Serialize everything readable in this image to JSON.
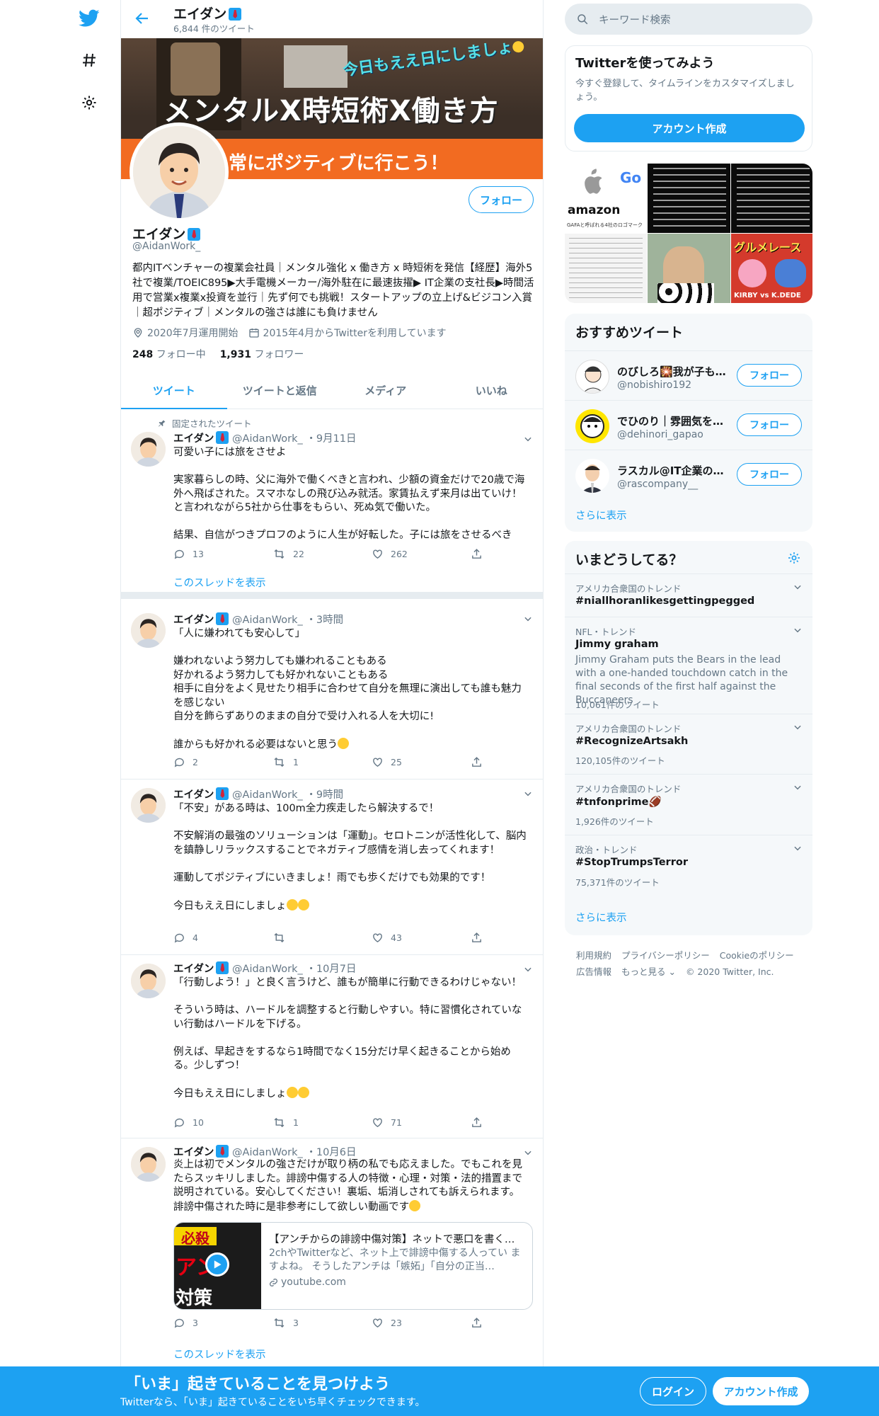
{
  "nav": {
    "icons": [
      "twitter-logo-icon",
      "explore-hashtag-icon",
      "settings-gear-icon"
    ]
  },
  "header": {
    "name": "エイダン",
    "tweet_count": "6,844 件のツイート"
  },
  "banner": {
    "line1": "メンタルX時短術X働き方",
    "line2": "今日もええ日にしましょ",
    "line3": "常にポジティブに行こう！"
  },
  "profile": {
    "follow_label": "フォロー",
    "name": "エイダン",
    "handle": "@AidanWork_",
    "bio": "都内ITベンチャーの複業会社員｜メンタル強化 x 働き方 x 時短術を発信【経歴】海外5社で複業/TOEIC895▶大手電機メーカー/海外駐在に最速抜擢▶ IT企業の支社長▶時間活用で営業x複業x投資を並行｜先ず何でも挑戦！スタートアップの立上げ&ビジコン入賞｜超ポジティブ｜メンタルの強さは誰にも負けません",
    "meta_started": "2020年7月運用開始",
    "meta_joined": "2015年4月からTwitterを利用しています",
    "following_count": "248",
    "following_label": "フォロー中",
    "followers_count": "1,931",
    "followers_label": "フォロワー"
  },
  "tabs": [
    "ツイート",
    "ツイートと返信",
    "メディア",
    "いいね"
  ],
  "tweets": [
    {
      "pinned_label": "固定されたツイート",
      "name": "エイダン",
      "handle": "@AidanWork_",
      "time": "・9月11日",
      "text": "可愛い子には旅をさせよ\n\n実家暮らしの時、父に海外で働くべきと言われ、少額の資金だけで20歳で海外へ飛ばされた。スマホなしの飛び込み就活。家賃払えず来月は出ていけ！と言われながら5社から仕事をもらい、死ぬ気で働いた。\n\n結果、自信がつきプロフのように人生が好転した。子には旅をさせるべき",
      "replies": "13",
      "retweets": "22",
      "likes": "262",
      "thread_label": "このスレッドを表示"
    },
    {
      "name": "エイダン",
      "handle": "@AidanWork_",
      "time": "・3時間",
      "text": "「人に嫌われても安心して」\n\n嫌われないよう努力しても嫌われることもある\n好かれるよう努力しても好かれないこともある\n相手に自分をよく見せたり相手に合わせて自分を無理に演出しても誰も魅力を感じない\n自分を飾らずありのままの自分で受け入れる人を大切に!\n\n誰からも好かれる必要はないと思う",
      "replies": "2",
      "retweets": "1",
      "likes": "25"
    },
    {
      "name": "エイダン",
      "handle": "@AidanWork_",
      "time": "・9時間",
      "text": "「不安」がある時は、100m全力疾走したら解決するで！\n\n不安解消の最強のソリューションは「運動」。セロトニンが活性化して、脳内を鎮静しリラックスすることでネガティブ感情を消し去ってくれます！\n\n運動してポジティブにいきましょ！雨でも歩くだけでも効果的です！\n\n今日もええ日にしましょ",
      "replies": "4",
      "retweets": "",
      "likes": "43"
    },
    {
      "name": "エイダン",
      "handle": "@AidanWork_",
      "time": "・10月7日",
      "text": "「行動しよう！」と良く言うけど、誰もが簡単に行動できるわけじゃない！\n\nそういう時は、ハードルを調整すると行動しやすい。特に習慣化されていない行動はハードルを下げる。\n\n例えば、早起きをするなら1時間でなく15分だけ早く起きることから始める。少しずつ！\n\n今日もええ日にしましょ",
      "replies": "10",
      "retweets": "1",
      "likes": "71"
    },
    {
      "name": "エイダン",
      "handle": "@AidanWork_",
      "time": "・10月6日",
      "text": "炎上は初でメンタルの強さだけが取り柄の私でも応えました。でもこれを見たらスッキリしました。誹謗中傷する人の特徴・心理・対策・法的措置まで説明されている。安心してください！裏垢、垢消しされても訴えられます。誹謗中傷された時に是非参考にして欲しい動画です",
      "card_title": "【アンチからの誹謗中傷対策】ネットで悪口を書く…",
      "card_desc": "2chやTwitterなど、ネット上で誹謗中傷する人ってい ますよね。 そうしたアンチは「嫉妬」「自分の正当…",
      "card_domain": "youtube.com",
      "card_thumb_top": "必殺",
      "card_thumb_mid": "アン",
      "card_thumb_bot": "対策",
      "replies": "3",
      "retweets": "3",
      "likes": "23",
      "thread_label": "このスレッドを表示"
    }
  ],
  "right": {
    "search_placeholder": "キーワード検索",
    "promo": {
      "title": "Twitterを使ってみよう",
      "desc": "今すぐ登録して、タイムラインをカスタマイズしましょう。",
      "button": "アカウント作成"
    },
    "wtf": {
      "title": "おすすめツイート",
      "users": [
        {
          "name": "のびしろ🎇我が子も…",
          "handle": "@nobishiro192",
          "follow": "フォロー"
        },
        {
          "name": "でひのり｜雰囲気を…",
          "handle": "@dehinori_gapao",
          "follow": "フォロー"
        },
        {
          "name": "ラスカル@IT企業の…",
          "handle": "@rascompany__",
          "follow": "フォロー"
        }
      ],
      "more": "さらに表示"
    },
    "trends": {
      "title": "いまどうしてる？",
      "items": [
        {
          "context": "アメリカ合衆国のトレンド",
          "topic": "#niallhoranlikesgettingpegged",
          "desc": "",
          "count": ""
        },
        {
          "context": "NFL・トレンド",
          "topic": "Jimmy graham",
          "desc": "Jimmy Graham puts the Bears in the lead with a one-handed touchdown catch in the final seconds of the first half against the Buccaneers",
          "count": "10,061件のツイート"
        },
        {
          "context": "アメリカ合衆国のトレンド",
          "topic": "#RecognizeArtsakh",
          "desc": "",
          "count": "120,105件のツイート"
        },
        {
          "context": "アメリカ合衆国のトレンド",
          "topic": "#tnfonprime🏈",
          "desc": "",
          "count": "1,926件のツイート"
        },
        {
          "context": "政治・トレンド",
          "topic": "#StopTrumpsTerror",
          "desc": "",
          "count": "75,371件のツイート"
        }
      ],
      "more": "さらに表示"
    },
    "footer": {
      "links": [
        "利用規約",
        "プライバシーポリシー",
        "Cookieのポリシー",
        "広告情報",
        "もっと見る ⌄"
      ],
      "copyright": "© 2020 Twitter, Inc."
    }
  },
  "bottom_bar": {
    "title": "「いま」起きていることを見つけよう",
    "subtitle": "Twitterなら、「いま」起きていることをいち早くチェックできます。",
    "login": "ログイン",
    "signup": "アカウント作成"
  },
  "photos": {
    "p1_brand": "amazon",
    "p1_caption": "GAFAと呼ばれる4社のロゴマーク",
    "p5_text": "グルメレース",
    "p5_sub": "KIRBY vs K.DEDE"
  },
  "colors": {
    "accent": "#1da1f2",
    "banner_orange": "#f26b21"
  }
}
